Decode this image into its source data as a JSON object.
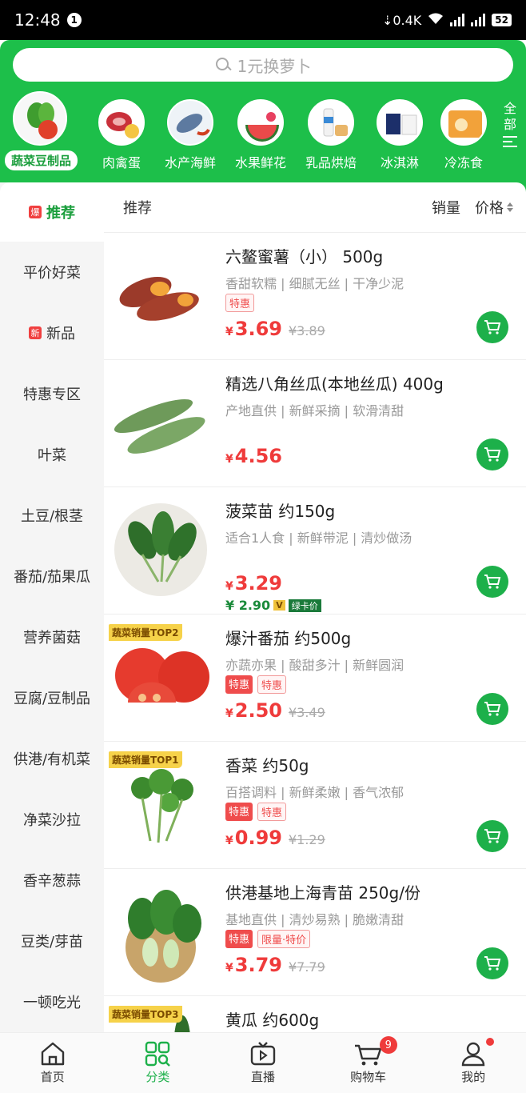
{
  "status_bar": {
    "time": "12:48",
    "notif": "1",
    "net_speed": "0.4K",
    "battery": "52"
  },
  "search": {
    "placeholder": "1元换萝卜"
  },
  "categories": [
    {
      "label": "蔬菜豆制品",
      "icon": "vegetable-icon"
    },
    {
      "label": "肉禽蛋",
      "icon": "meat-icon"
    },
    {
      "label": "水产海鲜",
      "icon": "seafood-icon"
    },
    {
      "label": "水果鲜花",
      "icon": "fruit-icon"
    },
    {
      "label": "乳品烘焙",
      "icon": "dairy-icon"
    },
    {
      "label": "冰淇淋",
      "icon": "icecream-icon"
    },
    {
      "label": "冷冻食",
      "icon": "frozen-icon"
    }
  ],
  "all_label": "全部",
  "sidebar": {
    "items": [
      {
        "label": "推荐",
        "tag": "爆"
      },
      {
        "label": "平价好菜"
      },
      {
        "label": "新品",
        "tag": "新"
      },
      {
        "label": "特惠专区"
      },
      {
        "label": "叶菜"
      },
      {
        "label": "土豆/根茎"
      },
      {
        "label": "番茄/茄果瓜"
      },
      {
        "label": "营养菌菇"
      },
      {
        "label": "豆腐/豆制品"
      },
      {
        "label": "供港/有机菜"
      },
      {
        "label": "净菜沙拉"
      },
      {
        "label": "香辛葱蒜"
      },
      {
        "label": "豆类/芽苗"
      },
      {
        "label": "一顿吃光"
      }
    ]
  },
  "sort_bar": {
    "recommend": "推荐",
    "sales": "销量",
    "price": "价格"
  },
  "products": [
    {
      "name": "六鳌蜜薯（小） 500g",
      "desc": "香甜软糯 | 细腻无丝 | 干净少泥",
      "tags": [
        "特惠"
      ],
      "price": "3.69",
      "old_price": "¥3.89",
      "currency": "¥"
    },
    {
      "name": "精选八角丝瓜(本地丝瓜) 400g",
      "desc": "产地直供 | 新鲜采摘 | 软滑清甜",
      "tags": [],
      "price": "4.56",
      "currency": "¥"
    },
    {
      "name": "菠菜苗 约150g",
      "desc": "适合1人食 | 新鲜带泥 | 清炒做汤",
      "tags": [],
      "price": "3.29",
      "member_price": "¥ 2.90",
      "member_v": "V",
      "member_label": "绿卡价",
      "currency": "¥"
    },
    {
      "name": "爆汁番茄 约500g",
      "desc": "亦蔬亦果 | 酸甜多汁 | 新鲜圆润",
      "tags": [
        "特惠",
        "特惠"
      ],
      "price": "2.50",
      "old_price": "¥3.49",
      "badge": "蔬菜销量TOP2",
      "currency": "¥"
    },
    {
      "name": "香菜 约50g",
      "desc": "百搭调料 | 新鲜柔嫩 | 香气浓郁",
      "tags": [
        "特惠",
        "特惠"
      ],
      "price": "0.99",
      "old_price": "¥1.29",
      "badge": "蔬菜销量TOP1",
      "currency": "¥"
    },
    {
      "name": "供港基地上海青苗 250g/份",
      "desc": "基地直供 | 清炒易熟 | 脆嫩清甜",
      "tags": [
        "特惠",
        "限量·特价"
      ],
      "price": "3.79",
      "old_price": "¥7.79",
      "currency": "¥"
    },
    {
      "name": "黄瓜 约600g",
      "badge": "蔬菜销量TOP3"
    }
  ],
  "bottom_nav": [
    {
      "label": "首页",
      "icon": "home-icon"
    },
    {
      "label": "分类",
      "icon": "category-icon"
    },
    {
      "label": "直播",
      "icon": "live-tv-icon"
    },
    {
      "label": "购物车",
      "icon": "cart-icon",
      "badge": "9"
    },
    {
      "label": "我的",
      "icon": "profile-icon"
    }
  ],
  "colors": {
    "brand_green": "#1dbf4a",
    "price_red": "#ef3b3b"
  }
}
